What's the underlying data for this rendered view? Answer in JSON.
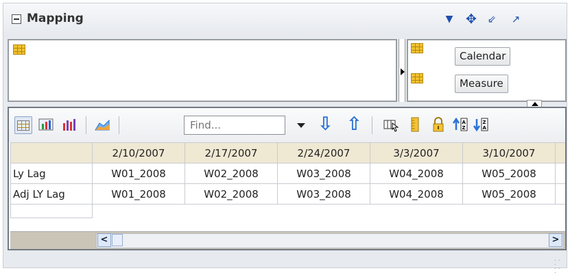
{
  "header": {
    "title": "Mapping",
    "icons": [
      "collapse-icon",
      "dropdown-icon",
      "move-icon",
      "restore-icon",
      "maximize-icon"
    ]
  },
  "mapping": {
    "dimensions": [
      {
        "label": "Calendar",
        "icon": "table-grid-icon"
      },
      {
        "label": "Measure",
        "icon": "table-grid-icon"
      }
    ]
  },
  "toolbar": {
    "find_placeholder": "Find...",
    "buttons": [
      "table-view",
      "chart-table-view",
      "bar-chart-view",
      "area-chart-view",
      "find-dropdown",
      "find-next",
      "find-previous",
      "select-columns",
      "ruler",
      "lock",
      "sort-ascending",
      "sort-descending"
    ]
  },
  "table": {
    "columns": [
      "2/10/2007",
      "2/17/2007",
      "2/24/2007",
      "3/3/2007",
      "3/10/2007"
    ],
    "rows": [
      {
        "label": "Ly Lag",
        "values": [
          "W01_2008",
          "W02_2008",
          "W03_2008",
          "W04_2008",
          "W05_2008"
        ]
      },
      {
        "label": "Adj LY Lag",
        "values": [
          "W01_2008",
          "W02_2008",
          "W03_2008",
          "W04_2008",
          "W05_2008"
        ]
      }
    ]
  },
  "colors": {
    "header_bg": "#e7eaee",
    "column_header_bg": "#efe8d3",
    "accent_blue": "#2b73d6"
  }
}
